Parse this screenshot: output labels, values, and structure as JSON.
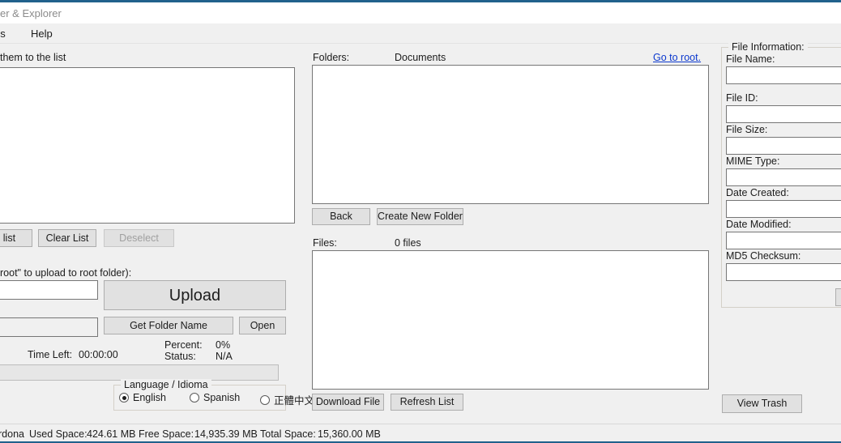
{
  "window": {
    "title": "er & Explorer",
    "accent_color": "#21618c"
  },
  "menu": {
    "items": [
      {
        "label": "ns"
      },
      {
        "label": "Help"
      }
    ]
  },
  "upload_panel": {
    "instruction": "them to the list",
    "selected_files_list": [],
    "buttons": {
      "remove_from_list": "om list",
      "clear_list": "Clear List",
      "deselect": "Deselect",
      "upload": "Upload",
      "get_folder_name": "Get Folder Name",
      "open": "Open"
    },
    "folder_hint": "root\" to upload to root folder):",
    "folder_input_value": "",
    "path_input_value": "",
    "progress": {
      "time_left_label": "Time Left:",
      "time_left_value": "00:00:00",
      "percent_label": "Percent:",
      "percent_value": "0%",
      "status_label": "Status:",
      "status_value": "N/A",
      "bar_percent": 0
    },
    "language": {
      "caption": "Language / Idioma",
      "options": [
        {
          "label": "English",
          "selected": true
        },
        {
          "label": "Spanish",
          "selected": false
        },
        {
          "label": "正體中文",
          "selected": false
        }
      ]
    }
  },
  "explorer_panel": {
    "folders_label": "Folders:",
    "current_folder": "Documents",
    "go_to_root_link": "Go to root.",
    "folders_list": [],
    "back_button": "Back",
    "create_new_folder_button": "Create New Folder",
    "files_label": "Files:",
    "files_count": "0 files",
    "files_list": [],
    "download_file_button": "Download File",
    "refresh_list_button": "Refresh List"
  },
  "file_info_panel": {
    "caption": "File Information:",
    "fields": [
      {
        "label": "File Name:",
        "value": ""
      },
      {
        "label": "File ID:",
        "value": ""
      },
      {
        "label": "File Size:",
        "value": ""
      },
      {
        "label": "MIME Type:",
        "value": ""
      },
      {
        "label": "Date Created:",
        "value": ""
      },
      {
        "label": "Date Modified:",
        "value": ""
      },
      {
        "label": "MD5 Checksum:",
        "value": ""
      }
    ],
    "action_button": ""
  },
  "trash": {
    "view_trash_button": "View Trash"
  },
  "statusbar": {
    "user": "rdona",
    "used_space_label": "Used Space:",
    "used_space_value": "424.61 MB",
    "free_space_label": "Free Space:",
    "free_space_value": "14,935.39 MB",
    "total_space_label": "Total Space:",
    "total_space_value": "15,360.00 MB"
  }
}
